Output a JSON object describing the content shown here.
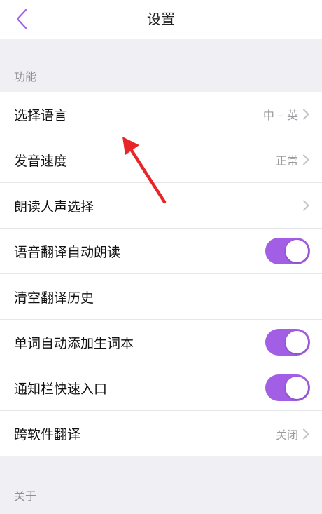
{
  "nav": {
    "title": "设置",
    "back_icon": "chevron-left-icon"
  },
  "colors": {
    "accent": "#a25fe6",
    "arrow": "#e8262a",
    "background": "#efeff4"
  },
  "sections": {
    "function": {
      "header": "功能",
      "rows": [
        {
          "label": "选择语言",
          "value": "中 – 英",
          "control": "chevron"
        },
        {
          "label": "发音速度",
          "value": "正常",
          "control": "chevron"
        },
        {
          "label": "朗读人声选择",
          "value": "",
          "control": "chevron"
        },
        {
          "label": "语音翻译自动朗读",
          "control": "toggle",
          "on": true
        },
        {
          "label": "清空翻译历史",
          "control": "none"
        },
        {
          "label": "单词自动添加生词本",
          "control": "toggle",
          "on": true
        },
        {
          "label": "通知栏快速入口",
          "control": "toggle",
          "on": true
        },
        {
          "label": "跨软件翻译",
          "value": "关闭",
          "control": "chevron"
        }
      ]
    },
    "about": {
      "header": "关于"
    }
  },
  "annotation": {
    "icon": "red-arrow-icon"
  }
}
